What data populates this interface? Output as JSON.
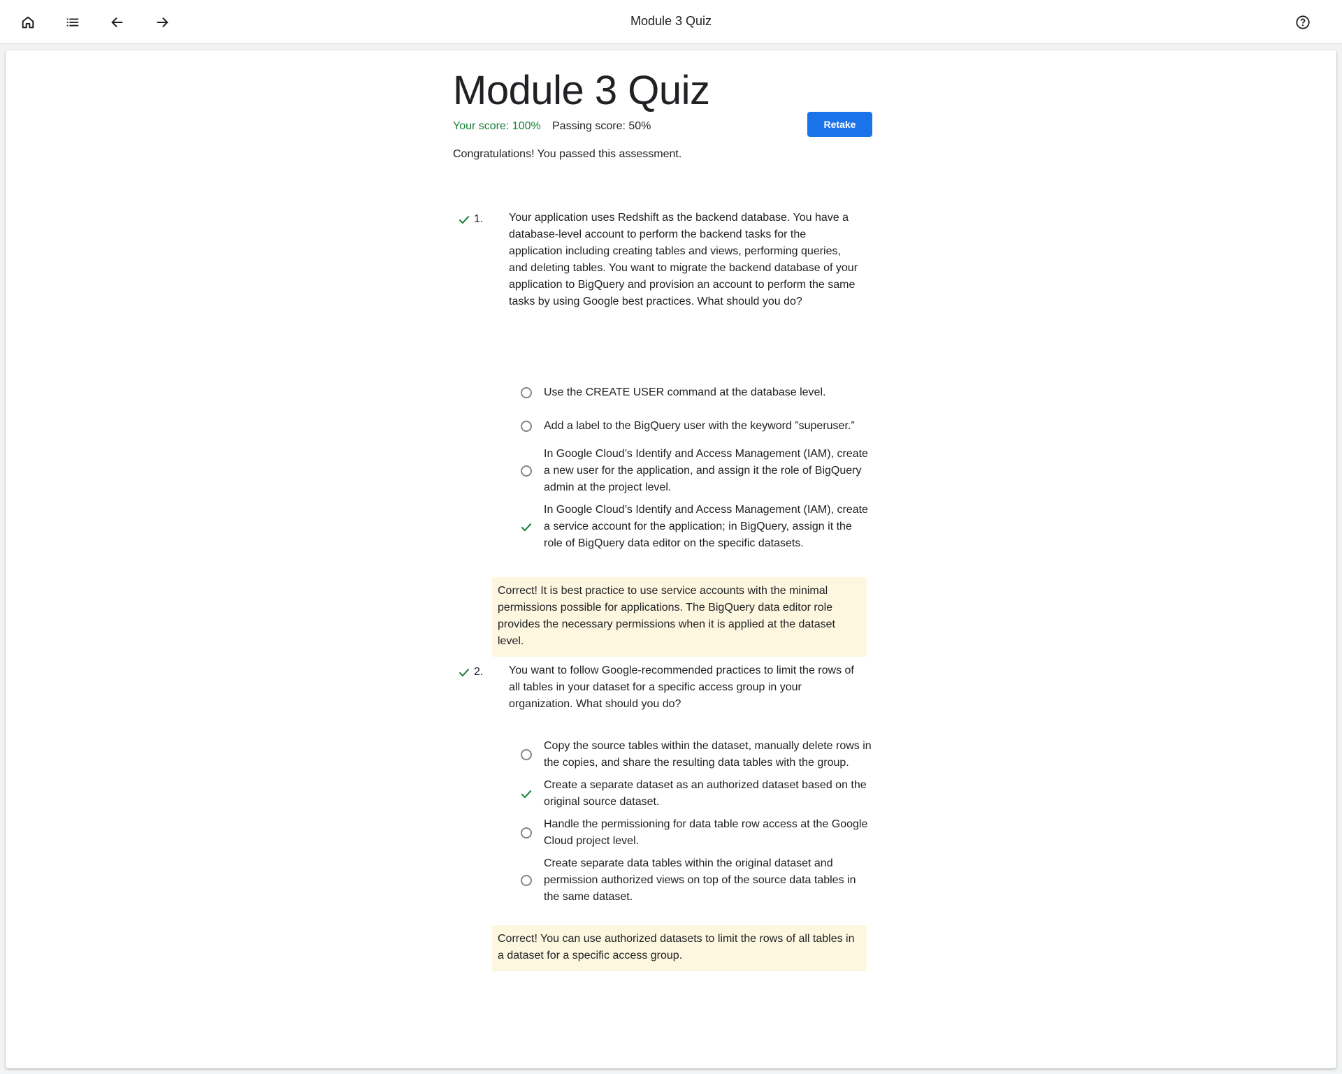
{
  "topbar": {
    "title": "Module 3 Quiz",
    "icons": [
      "home-icon",
      "list-icon",
      "arrow-back-icon",
      "arrow-forward-icon",
      "help-icon"
    ]
  },
  "quiz": {
    "title": "Module 3 Quiz",
    "score": "Your score: 100%",
    "passing": "Passing score: 50%",
    "retake_label": "Retake",
    "congrats": "Congratulations! You passed this assessment."
  },
  "questions": [
    {
      "number": "1.",
      "text": "Your application uses Redshift as the backend database. You have a database-level account to perform the backend tasks for the application including creating tables and views, performing queries, and deleting tables. You want to migrate the backend database of your application to BigQuery and provision an account to perform the same tasks by using Google best practices. What should you do?",
      "options": [
        "Use the CREATE USER command at the database level.",
        "Add a label to the BigQuery user with the keyword ”superuser.”",
        "In Google Cloud’s Identify and Access Management (IAM), create a new user for the application, and assign it the role of BigQuery admin at the project level.",
        "In Google Cloud’s Identify and Access Management (IAM), create a service account for the application; in BigQuery, assign it the role of BigQuery data editor on the specific datasets."
      ],
      "correct_index": 3,
      "feedback": "Correct! It is best practice to use service accounts with the minimal permissions possible for applications. The BigQuery data editor role provides the necessary permissions when it is applied at the dataset level."
    },
    {
      "number": "2.",
      "text": "You want to follow Google-recommended practices to limit the rows of all tables in your dataset for a specific access group in your organization. What should you do?",
      "options": [
        "Copy the source tables within the dataset, manually delete rows in the copies, and share the resulting data tables with the group.",
        "Create a separate dataset as an authorized dataset based on the original source dataset.",
        "Handle the permissioning for data table row access at the Google Cloud project level.",
        "Create separate data tables within the original dataset and permission authorized views on top of the source data tables in the same dataset."
      ],
      "correct_index": 1,
      "feedback": "Correct! You can use authorized datasets to limit the rows of all tables in a dataset for a specific access group."
    }
  ],
  "colors": {
    "accent": "#1a73e8",
    "success": "#188038",
    "feedback_bg": "#fef7e0"
  }
}
